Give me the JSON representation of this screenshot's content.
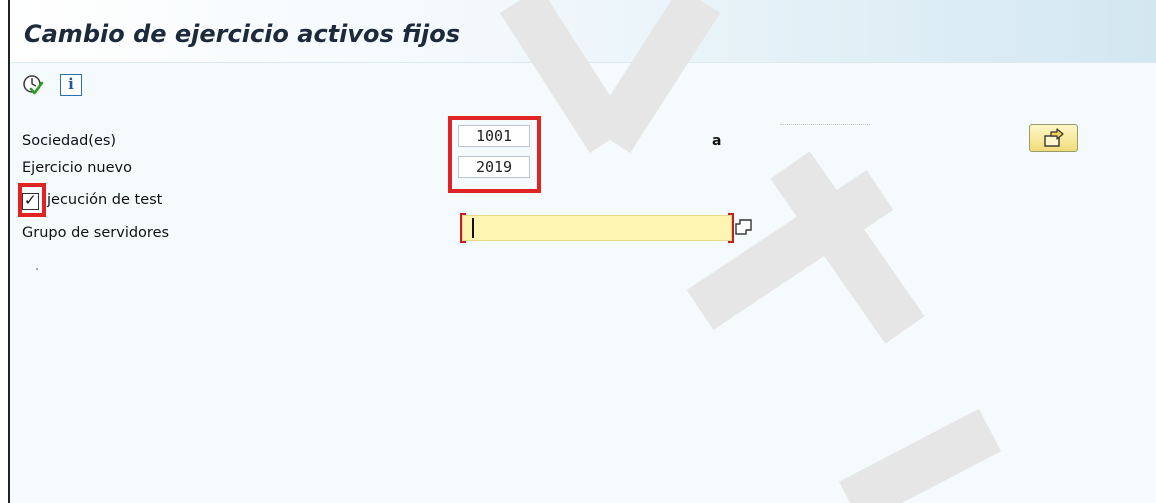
{
  "window": {
    "title": "Cambio de ejercicio activos fijos"
  },
  "toolbar": {
    "execute_icon": "execute-icon",
    "info_icon": "info-icon",
    "info_glyph": "i"
  },
  "form": {
    "sociedad": {
      "label": "Sociedad(es)",
      "value": "1001",
      "to_label": "a",
      "to_value": ""
    },
    "ejercicio": {
      "label": "Ejercicio nuevo",
      "value": "2019"
    },
    "test_run": {
      "label": "jecución de test",
      "checked": true,
      "check_glyph": "✓"
    },
    "grupo": {
      "label": "Grupo de servidores",
      "value": ""
    }
  },
  "colors": {
    "highlight": "#e02424",
    "required_field": "#fff5b3",
    "watermark": "#e6e6e6"
  }
}
